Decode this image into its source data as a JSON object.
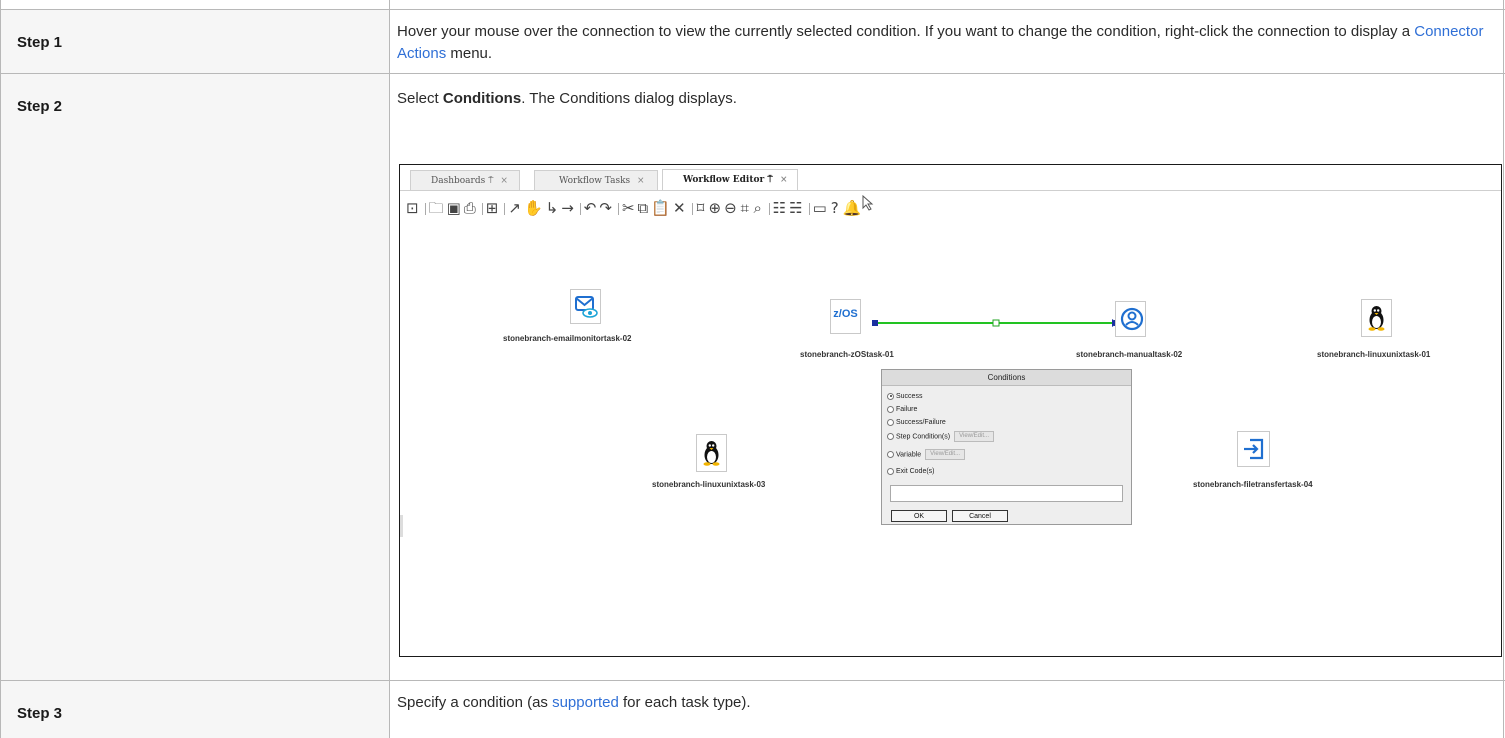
{
  "steps": [
    {
      "label": "Step 1",
      "text_before": "Hover your mouse over the connection to view the currently selected condition. If you want to change the condition, right-click the connection to display a ",
      "link": "Connector Actions",
      "text_after": " menu."
    },
    {
      "label": "Step 2",
      "bold": "Conditions",
      "text_after": ". The Conditions dialog displays."
    },
    {
      "label": "Step 3",
      "text_before": "Specify a condition (as ",
      "link": "supported",
      "text_after": " for each task type)."
    }
  ],
  "screenshot": {
    "tabs": [
      {
        "label": "Dashboards",
        "pin": "⍑",
        "close": "×"
      },
      {
        "label": "Workflow Tasks",
        "close": "×"
      },
      {
        "label": "Workflow Editor",
        "pin": "⍑",
        "close": "×"
      }
    ],
    "nodes": [
      {
        "label": "stonebranch-emailmonitortask-02",
        "icon": "email-monitor-icon"
      },
      {
        "label": "stonebranch-zOStask-01",
        "icon": "zos-icon",
        "icon_text": "z/OS"
      },
      {
        "label": "stonebranch-manualtask-02",
        "icon": "manual-task-icon"
      },
      {
        "label": "stonebranch-linuxunixtask-01",
        "icon": "linux-icon"
      },
      {
        "label": "stonebranch-linuxunixtask-03",
        "icon": "linux-icon"
      },
      {
        "label": "stonebranch-filetransfertask-04",
        "icon": "file-transfer-icon"
      }
    ],
    "connector_color": "#22c322",
    "dialog": {
      "title": "Conditions",
      "options": [
        {
          "label": "Success",
          "selected": true
        },
        {
          "label": "Failure",
          "selected": false
        },
        {
          "label": "Success/Failure",
          "selected": false
        },
        {
          "label": "Step Condition(s)",
          "selected": false,
          "button": "View/Edit..."
        },
        {
          "label": "Variable",
          "selected": false,
          "button": "View/Edit..."
        },
        {
          "label": "Exit Code(s)",
          "selected": false
        }
      ],
      "ok_label": "OK",
      "cancel_label": "Cancel"
    }
  },
  "colors": {
    "link": "#2f6fd6",
    "label_bg": "#f6f6f6",
    "border": "#b8b8b8"
  }
}
